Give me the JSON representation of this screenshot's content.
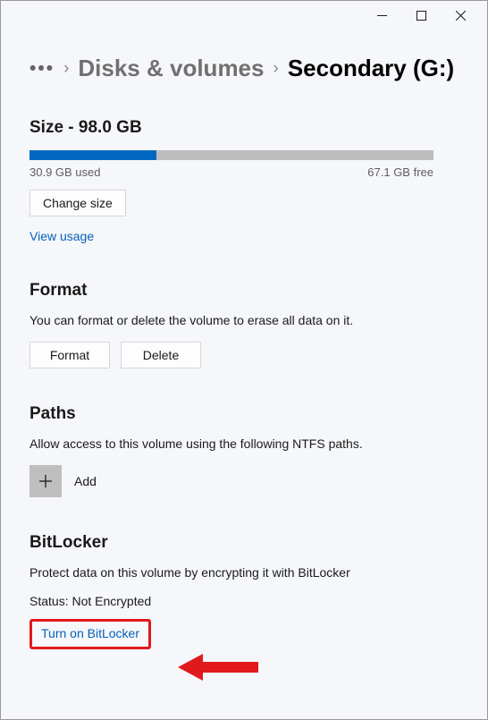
{
  "breadcrumb": {
    "parent": "Disks & volumes",
    "current": "Secondary (G:)"
  },
  "size": {
    "label_prefix": "Size - ",
    "total": "98.0 GB",
    "used_text": "30.9 GB used",
    "free_text": "67.1 GB free",
    "percent_used": 31.5,
    "change_size_label": "Change size",
    "view_usage_label": "View usage"
  },
  "format": {
    "title": "Format",
    "desc": "You can format or delete the volume to erase all data on it.",
    "format_btn": "Format",
    "delete_btn": "Delete"
  },
  "paths": {
    "title": "Paths",
    "desc": "Allow access to this volume using the following NTFS paths.",
    "add_label": "Add"
  },
  "bitlocker": {
    "title": "BitLocker",
    "desc": "Protect data on this volume by encrypting it with BitLocker",
    "status_prefix": "Status: ",
    "status_value": "Not Encrypted",
    "turn_on_label": "Turn on BitLocker"
  }
}
